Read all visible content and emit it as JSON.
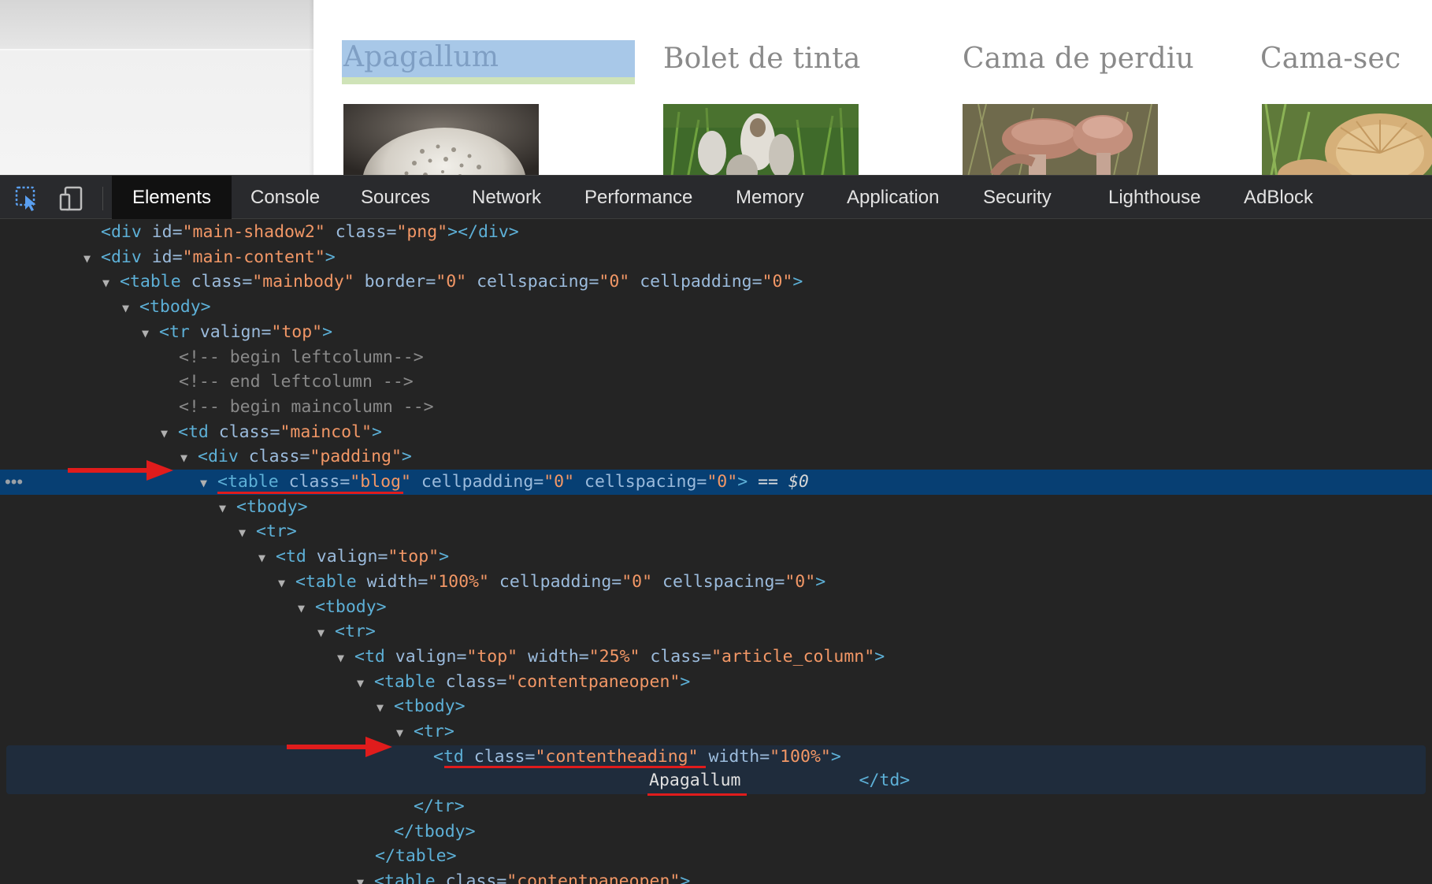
{
  "preview": {
    "articles": [
      {
        "title": "Apagallum",
        "selected": true,
        "image": "mushroom-photo-apagallum"
      },
      {
        "title": "Bolet de tinta",
        "selected": false,
        "image": "mushroom-photo-bolet-de-tinta"
      },
      {
        "title": "Cama de perdiu",
        "selected": false,
        "image": "mushroom-photo-cama-de-perdiu"
      },
      {
        "title": "Cama-sec",
        "selected": false,
        "image": "mushroom-photo-cama-sec"
      }
    ]
  },
  "devtools": {
    "toolbar": {
      "inspect_icon": "inspect-element-icon",
      "device_icon": "device-toolbar-icon",
      "tabs": [
        "Elements",
        "Console",
        "Sources",
        "Network",
        "Performance",
        "Memory",
        "Application",
        "Security",
        "Lighthouse",
        "AdBlock"
      ],
      "active_tab": "Elements"
    },
    "dom": {
      "l0": {
        "open": "<div ",
        "a1": "id=",
        "v1": "\"main-shadow2\"",
        "a2": " class=",
        "v2": "\"png\"",
        "close": "></div>"
      },
      "l1": {
        "open": "<div ",
        "a1": "id=",
        "v1": "\"main-content\"",
        "close": ">"
      },
      "l2": {
        "open": "<table ",
        "a1": "class=",
        "v1": "\"mainbody\"",
        "a2": " border=",
        "v2": "\"0\"",
        "a3": " cellspacing=",
        "v3": "\"0\"",
        "a4": " cellpadding=",
        "v4": "\"0\"",
        "close": ">"
      },
      "l3": {
        "open": "<tbody>"
      },
      "l4": {
        "open": "<tr ",
        "a1": "valign=",
        "v1": "\"top\"",
        "close": ">"
      },
      "l5": {
        "comment": "<!-- begin leftcolumn-->"
      },
      "l6": {
        "comment": "<!-- end leftcolumn -->"
      },
      "l7": {
        "comment": "<!-- begin maincolumn -->"
      },
      "l8": {
        "open": "<td ",
        "a1": "class=",
        "v1": "\"maincol\"",
        "close": ">"
      },
      "l9": {
        "open": "<div ",
        "a1": "class=",
        "v1": "\"padding\"",
        "close": ">"
      },
      "l10": {
        "open": "<table ",
        "a1": "class=",
        "v1": "\"blog\"",
        "a2": " cellpadding=",
        "v2": "\"0\"",
        "a3": " cellspacing=",
        "v3": "\"0\"",
        "close": ">",
        "eq": " == ",
        "ref": "$0"
      },
      "l11": {
        "open": "<tbody>"
      },
      "l12": {
        "open": "<tr>"
      },
      "l13": {
        "open": "<td ",
        "a1": "valign=",
        "v1": "\"top\"",
        "close": ">"
      },
      "l14": {
        "open": "<table ",
        "a1": "width=",
        "v1": "\"100%\"",
        "a2": " cellpadding=",
        "v2": "\"0\"",
        "a3": " cellspacing=",
        "v3": "\"0\"",
        "close": ">"
      },
      "l15": {
        "open": "<tbody>"
      },
      "l16": {
        "open": "<tr>"
      },
      "l17": {
        "open": "<td ",
        "a1": "valign=",
        "v1": "\"top\"",
        "a2": " width=",
        "v2": "\"25%\"",
        "a3": " class=",
        "v3": "\"article_column\"",
        "close": ">"
      },
      "l18": {
        "open": "<table ",
        "a1": "class=",
        "v1": "\"contentpaneopen\"",
        "close": ">"
      },
      "l19": {
        "open": "<tbody>"
      },
      "l20": {
        "open": "<tr>"
      },
      "l21": {
        "open": "<td ",
        "a1": "class=",
        "v1": "\"contentheading\"",
        "a2": " width=",
        "v2": "\"100%\"",
        "close": ">"
      },
      "l22": {
        "text": "Apagallum",
        "close": "</td>"
      },
      "l23": {
        "open": "</tr>"
      },
      "l24": {
        "open": "</tbody>"
      },
      "l25": {
        "open": "</table>"
      },
      "l26": {
        "open": "<table ",
        "a1": "class=",
        "v1": "\"contentpaneopen\"",
        "close": ">"
      }
    },
    "colors": {
      "selected_row": "#073f73",
      "annotation": "#e01c1c",
      "tag": "#5db0d7",
      "value": "#f29766"
    }
  }
}
